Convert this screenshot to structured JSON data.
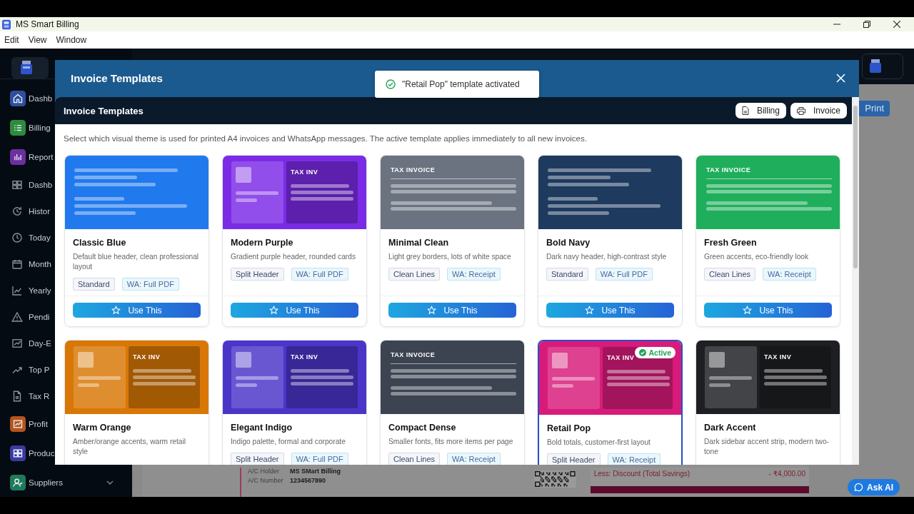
{
  "window": {
    "title": "MS Smart Billing"
  },
  "menu": [
    "Edit",
    "View",
    "Window"
  ],
  "sidebar": {
    "items": [
      {
        "label": "Dashb",
        "color": "#2f4f9e"
      },
      {
        "label": "Billing",
        "color": "#2e8b3e"
      },
      {
        "label": "Report",
        "color": "#6b2fa0"
      },
      {
        "label": "Dashb"
      },
      {
        "label": "Histor"
      },
      {
        "label": "Today"
      },
      {
        "label": "Month"
      },
      {
        "label": "Yearly"
      },
      {
        "label": "Pendi"
      },
      {
        "label": "Day-E"
      },
      {
        "label": "Top P"
      },
      {
        "label": "Tax R"
      },
      {
        "label": "Profit",
        "color": "#b5541c"
      },
      {
        "label": "Produc",
        "color": "#3b3aa0"
      },
      {
        "label": "Suppliers",
        "color": "#1f7a5a"
      }
    ]
  },
  "header": {
    "print_button": "Print"
  },
  "modal": {
    "title": "Invoice Templates",
    "panel_title": "Invoice Templates",
    "panel_buttons": [
      "Billing",
      "Invoice"
    ],
    "intro": "Select which visual theme is used for printed A4 invoices and WhatsApp messages. The active template applies immediately to all new invoices.",
    "templates": [
      {
        "name": "Classic Blue",
        "description": "Default blue header, clean professional layout",
        "preview": {
          "kind": "lines",
          "color": "#2179ee"
        },
        "tags": [
          {
            "label": "Standard",
            "kind": "style"
          },
          {
            "label": "WA: Full PDF",
            "kind": "wa"
          }
        ],
        "button": "Use This",
        "selected": false
      },
      {
        "name": "Modern Purple",
        "description": "Gradient purple header, rounded cards",
        "preview": {
          "kind": "split",
          "color": "#7b2be6",
          "heading": "TAX INV"
        },
        "tags": [
          {
            "label": "Split Header",
            "kind": "style"
          },
          {
            "label": "WA: Full PDF",
            "kind": "wa"
          }
        ],
        "button": "Use This",
        "selected": false
      },
      {
        "name": "Minimal Clean",
        "description": "Light grey borders, lots of white space",
        "preview": {
          "kind": "tax",
          "color": "#6b7280",
          "heading": "TAX INVOICE"
        },
        "tags": [
          {
            "label": "Clean Lines",
            "kind": "style"
          },
          {
            "label": "WA: Receipt",
            "kind": "wa"
          }
        ],
        "button": "Use This",
        "selected": false
      },
      {
        "name": "Bold Navy",
        "description": "Dark navy header, high-contrast style",
        "preview": {
          "kind": "lines",
          "color": "#1e3a5f"
        },
        "tags": [
          {
            "label": "Standard",
            "kind": "style"
          },
          {
            "label": "WA: Full PDF",
            "kind": "wa"
          }
        ],
        "button": "Use This",
        "selected": false
      },
      {
        "name": "Fresh Green",
        "description": "Green accents, eco-friendly look",
        "preview": {
          "kind": "tax",
          "color": "#1fae5b",
          "heading": "TAX INVOICE"
        },
        "tags": [
          {
            "label": "Clean Lines",
            "kind": "style"
          },
          {
            "label": "WA: Receipt",
            "kind": "wa"
          }
        ],
        "button": "Use This",
        "selected": false
      },
      {
        "name": "Warm Orange",
        "description": "Amber/orange accents, warm retail style",
        "preview": {
          "kind": "split",
          "color": "#d97706",
          "heading": "TAX INV"
        },
        "selected": false
      },
      {
        "name": "Elegant Indigo",
        "description": "Indigo palette, formal and corporate",
        "preview": {
          "kind": "split",
          "color": "#4b35c9",
          "heading": "TAX INV"
        },
        "tags": [
          {
            "label": "Split Header",
            "kind": "style"
          },
          {
            "label": "WA: Full PDF",
            "kind": "wa"
          }
        ],
        "selected": false
      },
      {
        "name": "Compact Dense",
        "description": "Smaller fonts, fits more items per page",
        "preview": {
          "kind": "tax",
          "color": "#3d4451",
          "heading": "TAX INVOICE"
        },
        "tags": [
          {
            "label": "Clean Lines",
            "kind": "style"
          },
          {
            "label": "WA: Receipt",
            "kind": "wa"
          }
        ],
        "selected": false
      },
      {
        "name": "Retail Pop",
        "description": "Bold totals, customer-first layout",
        "preview": {
          "kind": "split",
          "color": "#d81b7a",
          "heading": "TAX INV"
        },
        "tags": [
          {
            "label": "Split Header",
            "kind": "style"
          },
          {
            "label": "WA: Receipt",
            "kind": "wa"
          }
        ],
        "badge": "Active",
        "selected": true
      },
      {
        "name": "Dark Accent",
        "description": "Dark sidebar accent strip, modern two-tone",
        "preview": {
          "kind": "split",
          "color": "#1e1f22",
          "heading": "TAX INV"
        },
        "selected": false
      }
    ]
  },
  "toast": {
    "message": "\"Retail Pop\" template activated"
  },
  "invoice_strip": {
    "rows": [
      {
        "label": "A/C Holder",
        "value": "MS SMart Billing"
      },
      {
        "label": "A/C Number",
        "value": "1234567890"
      }
    ],
    "discount_label": "Less: Discount (Total Savings)",
    "discount_amount": "- ₹4,000.00"
  },
  "ask_ai": "Ask AI"
}
